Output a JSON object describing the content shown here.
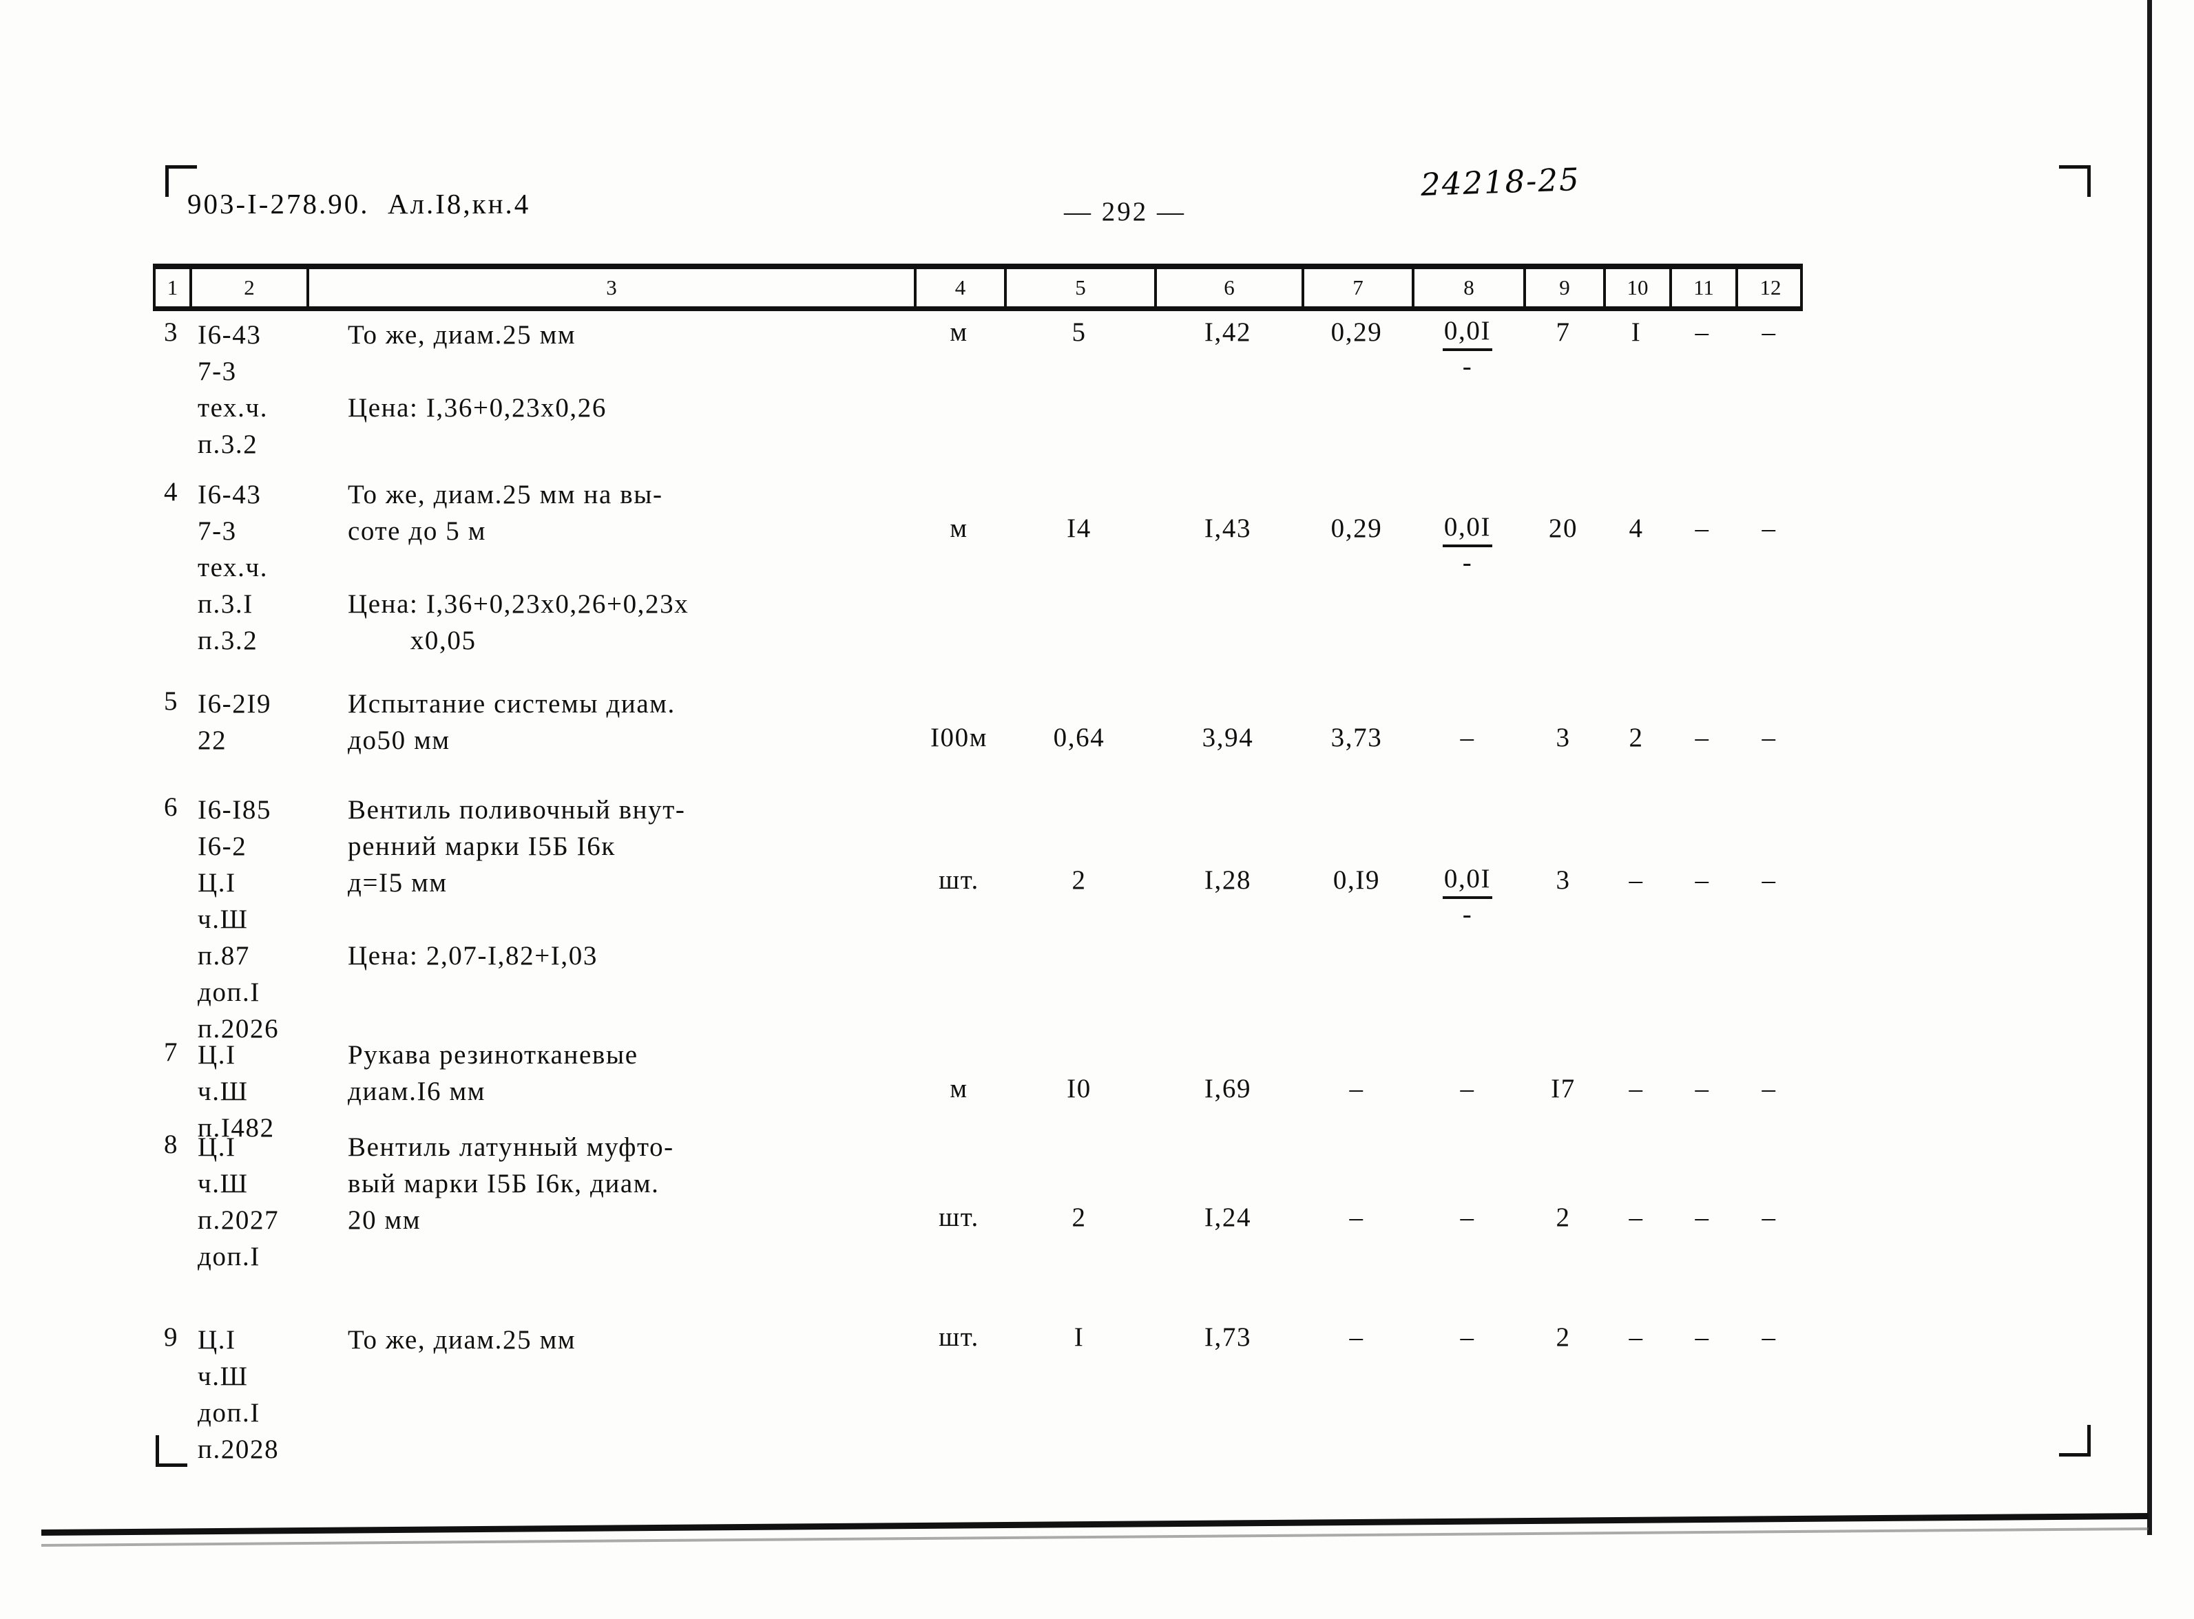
{
  "document": {
    "code": "903-I-278.90.  Ал.I8,кн.4",
    "page_number": "— 292 —",
    "archive_mark": "24218-25"
  },
  "table": {
    "column_headers": [
      "1",
      "2",
      "3",
      "4",
      "5",
      "6",
      "7",
      "8",
      "9",
      "10",
      "11",
      "12"
    ],
    "rows": [
      {
        "num": "3",
        "codes": [
          "I6-43",
          "7-3",
          "тех.ч.",
          "п.3.2"
        ],
        "desc": [
          "То же, диам.25 мм",
          "",
          "Цена: I,36+0,23х0,26"
        ],
        "unit": "м",
        "c5": "5",
        "c6": "I,42",
        "c7": "0,29",
        "c8_num": "0,0I",
        "c8_den": "-",
        "c9": "7",
        "c10": "I",
        "c11": "–",
        "c12": "–"
      },
      {
        "num": "4",
        "codes": [
          "I6-43",
          "7-3",
          "тех.ч.",
          "п.3.I",
          "п.3.2"
        ],
        "desc": [
          "То же, диам.25 мм на вы-",
          "соте до 5 м",
          "",
          "Цена: I,36+0,23х0,26+0,23х",
          "        х0,05"
        ],
        "unit": "м",
        "c5": "I4",
        "c6": "I,43",
        "c7": "0,29",
        "c8_num": "0,0I",
        "c8_den": "-",
        "c9": "20",
        "c10": "4",
        "c11": "–",
        "c12": "–"
      },
      {
        "num": "5",
        "codes": [
          "I6-2I9",
          "22"
        ],
        "desc": [
          "Испытание системы диам.",
          "до50 мм"
        ],
        "unit": "I00м",
        "c5": "0,64",
        "c6": "3,94",
        "c7": "3,73",
        "c8_num": "",
        "c8_den": "",
        "c8_plain": "–",
        "c9": "3",
        "c10": "2",
        "c11": "–",
        "c12": "–"
      },
      {
        "num": "6",
        "codes": [
          "I6-I85",
          "I6-2",
          "Ц.I",
          "ч.Ш",
          "п.87",
          "доп.I",
          "п.2026"
        ],
        "desc": [
          "Вентиль поливочный внут-",
          "ренний марки I5Б I6к",
          "д=I5 мм",
          "",
          "Цена: 2,07-I,82+I,03"
        ],
        "unit": "шт.",
        "c5": "2",
        "c6": "I,28",
        "c7": "0,I9",
        "c8_num": "0,0I",
        "c8_den": "-",
        "c9": "3",
        "c10": "–",
        "c11": "–",
        "c12": "–"
      },
      {
        "num": "7",
        "codes": [
          "Ц.I",
          "ч.Ш",
          "п.I482"
        ],
        "desc": [
          "Рукава резинотканевые",
          "диам.I6 мм"
        ],
        "unit": "м",
        "c5": "I0",
        "c6": "I,69",
        "c7": "–",
        "c8_plain": "–",
        "c9": "I7",
        "c10": "–",
        "c11": "–",
        "c12": "–"
      },
      {
        "num": "8",
        "codes": [
          "Ц.I",
          "ч.Ш",
          "п.2027",
          "доп.I"
        ],
        "desc": [
          "Вентиль латунный муфто-",
          "вый марки I5Б I6к, диам.",
          "20 мм"
        ],
        "unit": "шт.",
        "c5": "2",
        "c6": "I,24",
        "c7": "–",
        "c8_plain": "–",
        "c9": "2",
        "c10": "–",
        "c11": "–",
        "c12": "–"
      },
      {
        "num": "9",
        "codes": [
          "Ц.I",
          "ч.Ш",
          "доп.I",
          "п.2028"
        ],
        "desc": [
          "То же, диам.25 мм"
        ],
        "unit": "шт.",
        "c5": "I",
        "c6": "I,73",
        "c7": "–",
        "c8_plain": "–",
        "c9": "2",
        "c10": "–",
        "c11": "–",
        "c12": "–"
      }
    ]
  }
}
